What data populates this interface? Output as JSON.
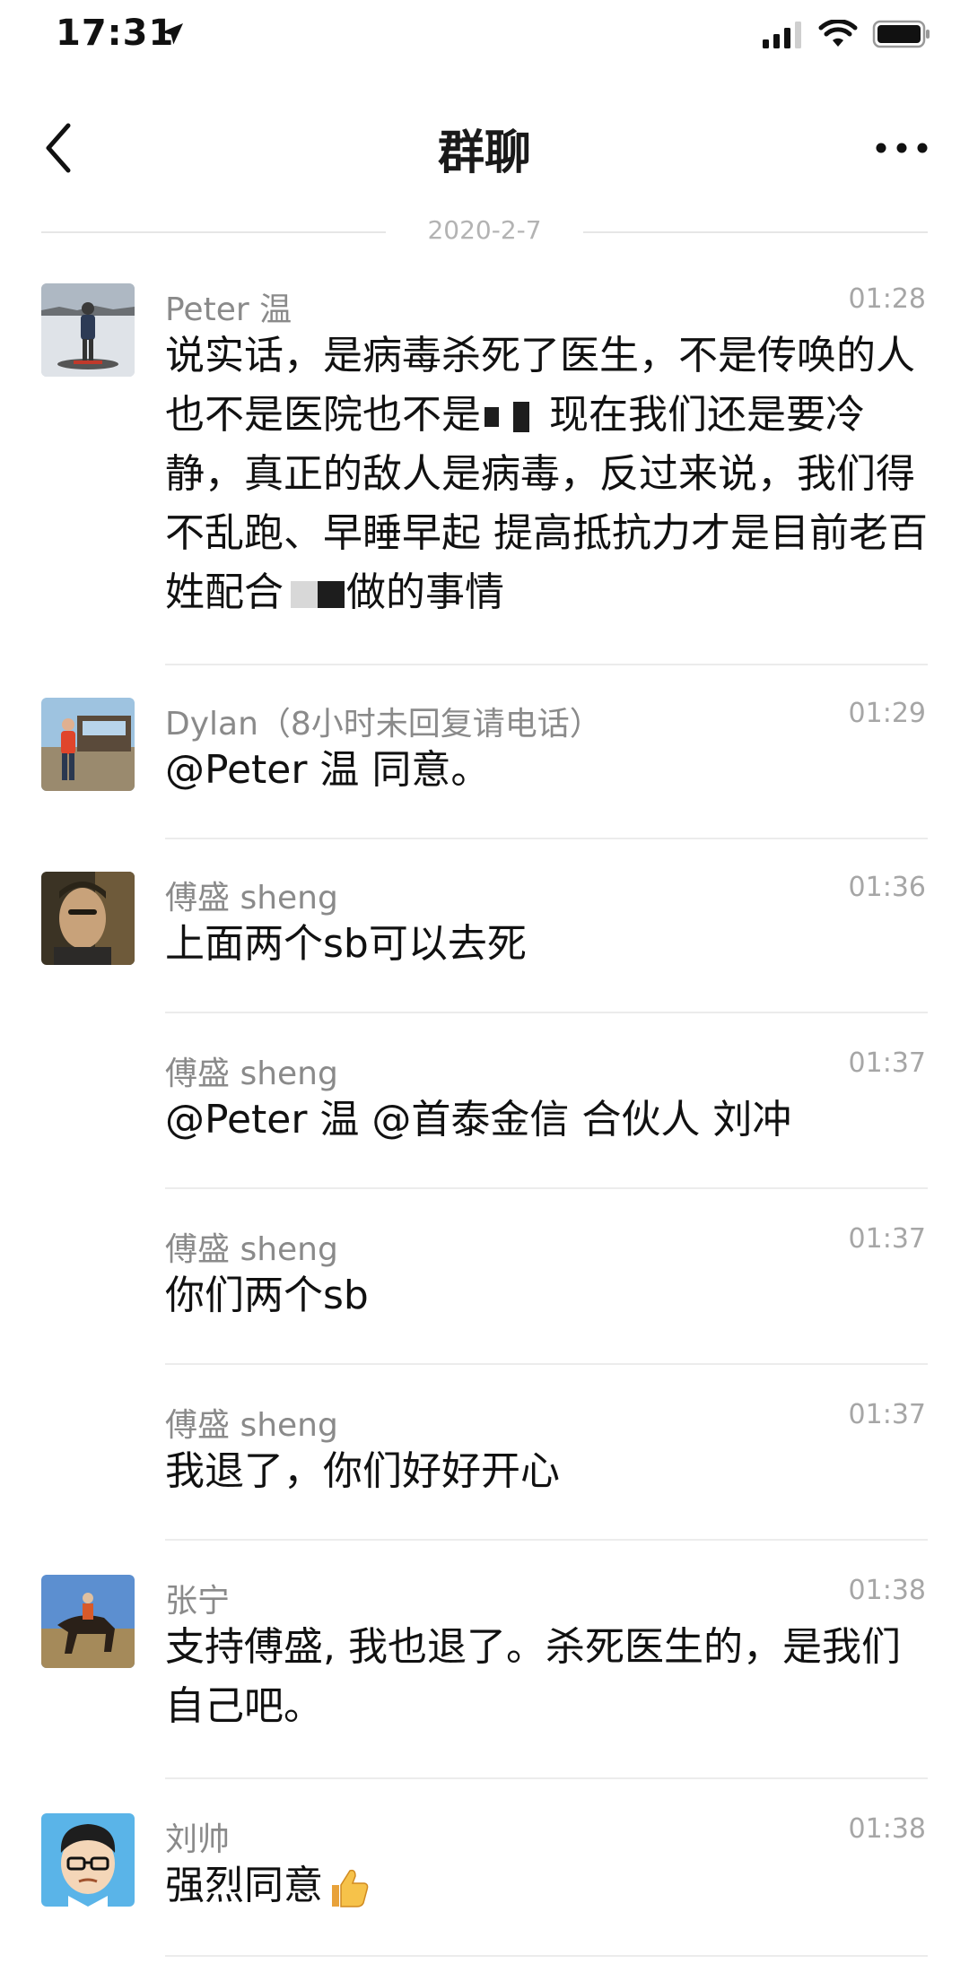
{
  "status_bar": {
    "time": "17:31"
  },
  "nav": {
    "title": "群聊"
  },
  "date_divider": "2020-2-7",
  "messages": [
    {
      "sender": "Peter 温",
      "time": "01:28",
      "text_a": "说实话，是病毒杀死了医生，不是传唤的人也不是医院也不是",
      "text_b": "现在我们还是要冷静，真正的敌人是病毒，反过来说，我们得不乱跑、早睡早起 提高抵抗力才是目前老百姓配合",
      "text_c": "做的事情"
    },
    {
      "sender": "Dylan（8小时未回复请电话）",
      "time": "01:29",
      "text": "@Peter 温 同意。"
    },
    {
      "sender": "傅盛 sheng",
      "time": "01:36",
      "text": "上面两个sb可以去死"
    },
    {
      "sender": "傅盛 sheng",
      "time": "01:37",
      "text": "@Peter 温 @首泰金信 合伙人 刘冲"
    },
    {
      "sender": "傅盛 sheng",
      "time": "01:37",
      "text": "你们两个sb"
    },
    {
      "sender": "傅盛 sheng",
      "time": "01:37",
      "text": "我退了，你们好好开心"
    },
    {
      "sender": "张宁",
      "time": "01:38",
      "text": "支持傅盛, 我也退了。杀死医生的，是我们自己吧。"
    },
    {
      "sender": "刘帅",
      "time": "01:38",
      "text": "强烈同意"
    }
  ],
  "icons": {
    "location": "location-arrow-icon",
    "signal": "signal-icon",
    "wifi": "wifi-icon",
    "battery": "battery-icon",
    "back": "chevron-left-icon",
    "more": "more-dots-icon",
    "thumbs_up": "thumbs-up-icon"
  },
  "colors": {
    "sender": "#8a8a8a",
    "time": "#a6a6a6",
    "separator": "#ececec",
    "text": "#111111"
  }
}
